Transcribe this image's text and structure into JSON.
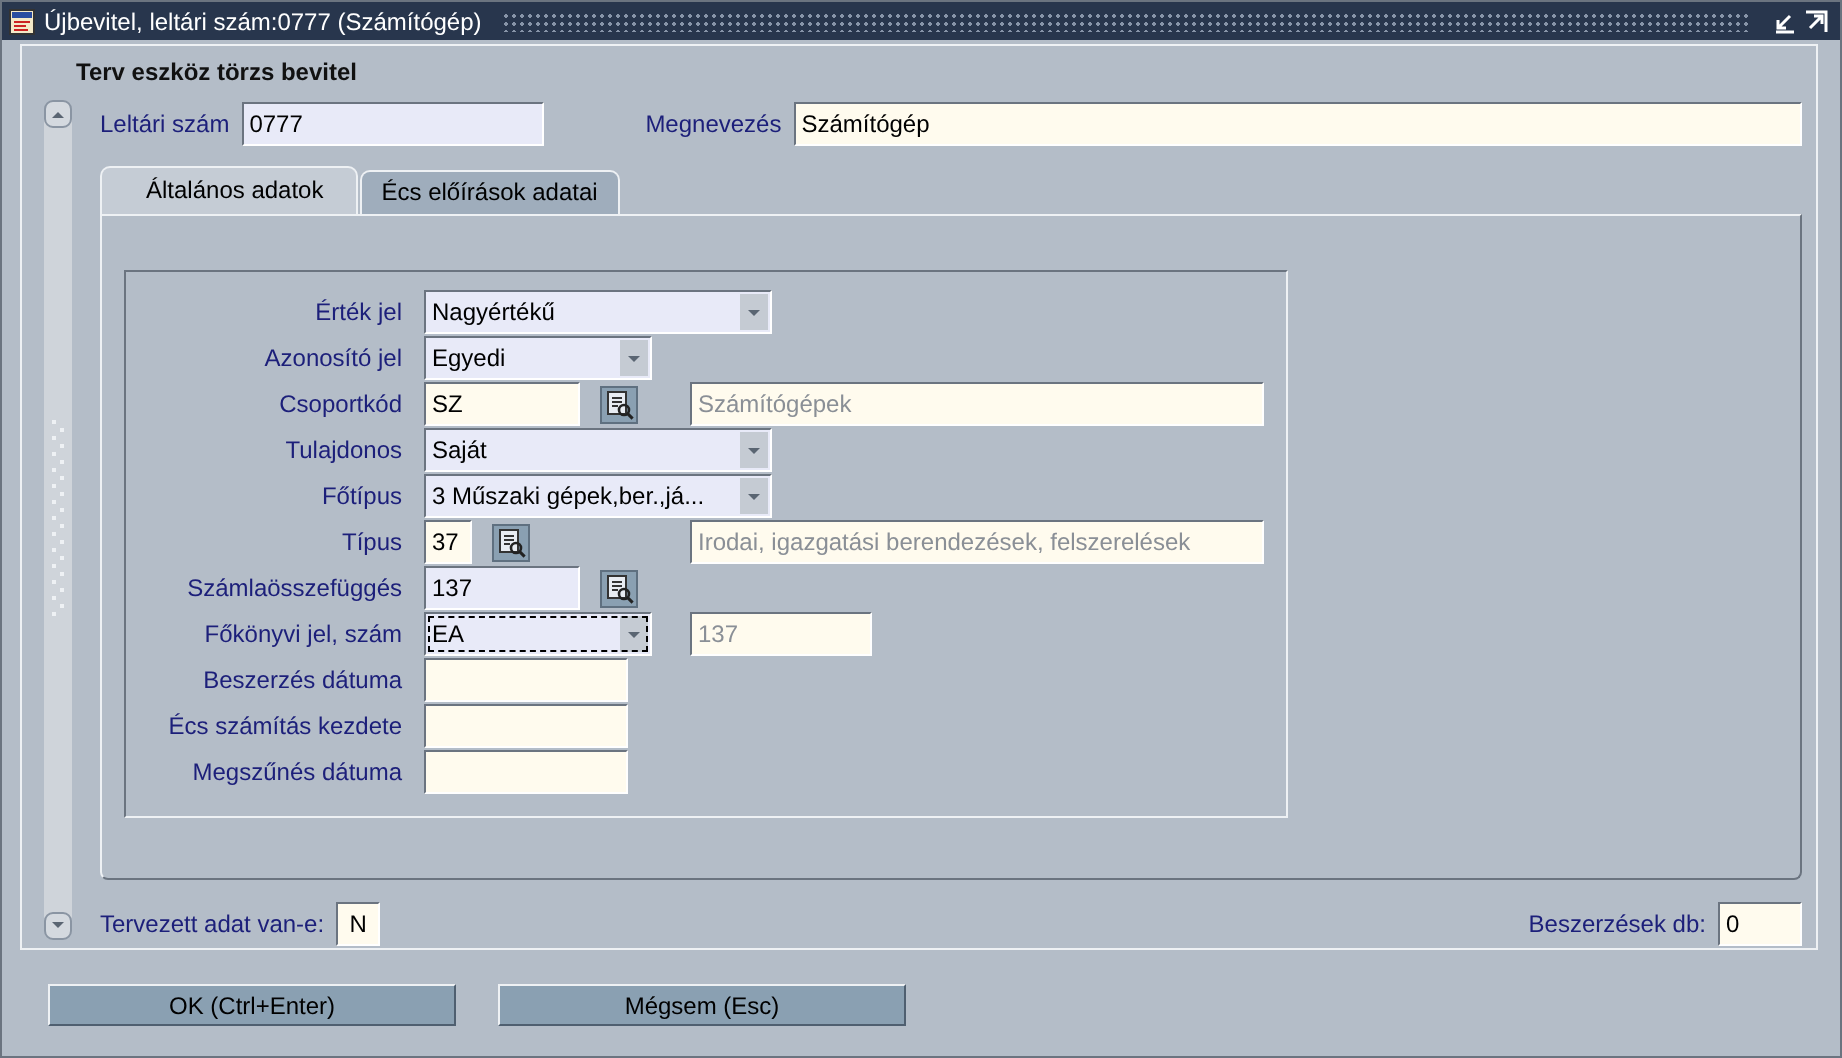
{
  "window": {
    "title": "Újbevitel, leltári szám:0777 (Számítógép)"
  },
  "header": "Terv eszköz törzs bevitel",
  "top_fields": [
    {
      "label": "Leltári szám",
      "value": "0777",
      "required": true
    },
    {
      "label": "Megnevezés",
      "value": "Számítógép",
      "required": false
    }
  ],
  "tabs": [
    {
      "label": "Általános adatok",
      "selected": true
    },
    {
      "label": "Écs előírások adatai",
      "selected": false
    }
  ],
  "form_rows": [
    {
      "label": "Érték jel",
      "field": {
        "kind": "dropdown",
        "value": "Nagyértékű",
        "required": true,
        "focused": false
      }
    },
    {
      "label": "Azonosító jel",
      "field": {
        "kind": "dropdown",
        "value": "Egyedi",
        "required": true,
        "focused": false
      }
    },
    {
      "label": "Csoportkód",
      "field": {
        "kind": "text",
        "value": "SZ",
        "required": false,
        "focused": false
      },
      "lookup": true,
      "display": "Számítógépek"
    },
    {
      "label": "Tulajdonos",
      "field": {
        "kind": "dropdown",
        "value": "Saját",
        "required": true,
        "focused": false
      }
    },
    {
      "label": "Főtípus",
      "field": {
        "kind": "dropdown",
        "value": "3 Műszaki gépek,ber.,já...",
        "required": true,
        "focused": false
      }
    },
    {
      "label": "Típus",
      "field": {
        "kind": "text",
        "value": "37",
        "required": false,
        "focused": false
      },
      "lookup": true,
      "display": "Irodai, igazgatási berendezések, felszerelések"
    },
    {
      "label": "Számlaösszefüggés",
      "field": {
        "kind": "text",
        "value": "137",
        "required": true,
        "focused": false
      },
      "lookup": true
    },
    {
      "label": "Főkönyvi jel, szám",
      "field": {
        "kind": "dropdown",
        "value": "EA",
        "required": true,
        "focused": true
      },
      "display": "137"
    },
    {
      "label": "Beszerzés dátuma",
      "field": {
        "kind": "text",
        "required": false,
        "focused": false
      }
    },
    {
      "label": "Écs számítás kezdete",
      "field": {
        "kind": "text",
        "required": false,
        "focused": false
      }
    },
    {
      "label": "Megszűnés dátuma",
      "field": {
        "kind": "text",
        "required": false,
        "focused": false
      }
    }
  ],
  "bottom_fields": [
    {
      "label": "Tervezett adat van-e:",
      "value": "N"
    },
    {
      "label": "Beszerzések db:",
      "value": "0"
    }
  ],
  "buttons": [
    "OK (Ctrl+Enter)",
    "Mégsem (Esc)"
  ]
}
